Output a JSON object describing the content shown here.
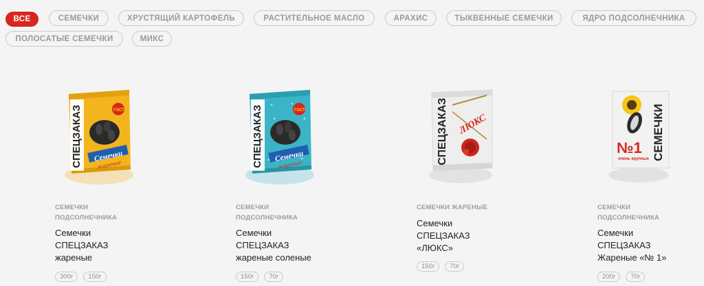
{
  "filters": [
    "ВСЕ",
    "СЕМЕЧКИ",
    "ХРУСТЯЩИЙ КАРТОФЕЛЬ",
    "РАСТИТЕЛЬНОЕ МАСЛО",
    "АРАХИС",
    "ТЫКВЕННЫЕ СЕМЕЧКИ",
    "ЯДРО ПОДСОЛНЕЧНИКА",
    "ПОЛОСАТЫЕ СЕМЕЧКИ",
    "МИКС"
  ],
  "colors": {
    "accent": "#d7261e",
    "pack_yellow": "#f3b51e",
    "pack_blue": "#39b3c6",
    "pack_white": "#efefef"
  },
  "products": [
    {
      "category_line1": "СЕМЕЧКИ",
      "category_line2": "ПОДСОЛНЕЧНИКА",
      "name_line1": "Семечки",
      "name_line2": "СПЕЦЗАКАЗ",
      "name_line3": "жареные",
      "weights": [
        "300г",
        "150г"
      ],
      "pack": {
        "brand": "СПЕЦЗАКАЗ",
        "script": "Семечки",
        "sub": "жареные",
        "badge": "ГОСТ"
      }
    },
    {
      "category_line1": "СЕМЕЧКИ",
      "category_line2": "ПОДСОЛНЕЧНИКА",
      "name_line1": "Семечки",
      "name_line2": "СПЕЦЗАКАЗ",
      "name_line3": "жареные соленые",
      "weights": [
        "150г",
        "70г"
      ],
      "pack": {
        "brand": "СПЕЦЗАКАЗ",
        "script": "Семечки",
        "sub": "жареные",
        "badge": "ГОСТ"
      }
    },
    {
      "category_line1": "СЕМЕЧКИ ЖАРЕНЫЕ",
      "category_line2": "",
      "name_line1": "Семечки",
      "name_line2": "СПЕЦЗАКАЗ",
      "name_line3": "«ЛЮКС»",
      "weights": [
        "150г",
        "70г"
      ],
      "pack": {
        "brand": "СПЕЦЗАКАЗ",
        "script": "ЛЮКС"
      }
    },
    {
      "category_line1": "СЕМЕЧКИ",
      "category_line2": "ПОДСОЛНЕЧНИКА",
      "name_line1": "Семечки",
      "name_line2": "СПЕЦЗАКАЗ",
      "name_line3": "Жареные «№ 1»",
      "weights": [
        "200г",
        "70г"
      ],
      "pack": {
        "brand": "СЕМЕЧКИ",
        "script": "№1",
        "sub": "очень крупные"
      }
    }
  ]
}
